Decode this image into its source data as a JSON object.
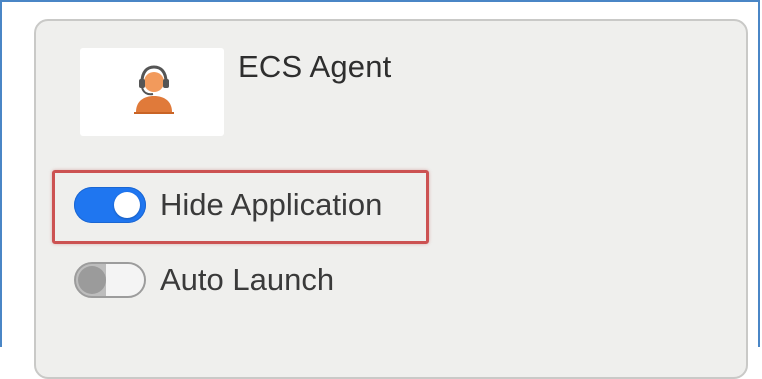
{
  "app": {
    "name": "ECS Agent",
    "icon": "agent-headset-icon"
  },
  "settings": [
    {
      "label": "Hide Application",
      "enabled": true
    },
    {
      "label": "Auto Launch",
      "enabled": false
    }
  ],
  "colors": {
    "toggle_on": "#1f76f0",
    "toggle_off": "#bdbdbd",
    "highlight": "#cc5252",
    "card_bg": "#efefed",
    "frame_border": "#4a86c6",
    "agent_icon": "#e07a3a"
  }
}
